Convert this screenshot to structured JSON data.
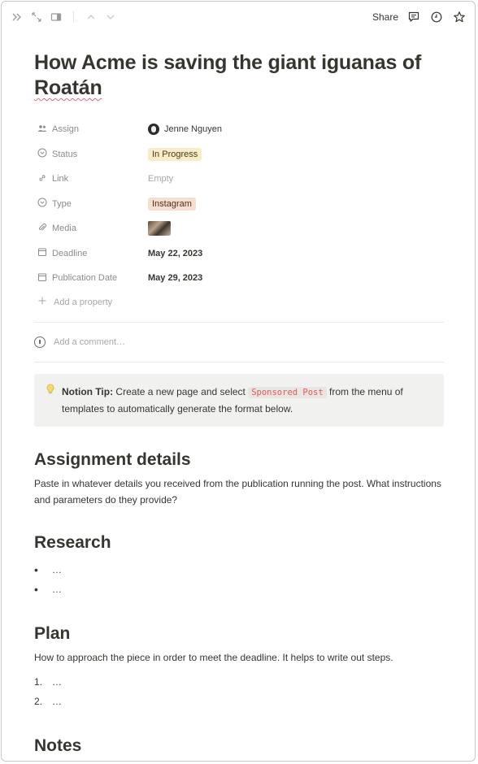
{
  "topbar": {
    "share_label": "Share",
    "icons": [
      "double-chevron-right-icon",
      "expand-icon",
      "sidebar-toggle-icon",
      "chevron-up-icon",
      "chevron-down-icon",
      "comment-icon",
      "clock-icon",
      "star-icon",
      "more-icon"
    ]
  },
  "page": {
    "title_part1": "How Acme is saving the giant iguanas of ",
    "title_part2": "Roatán"
  },
  "properties": [
    {
      "key": "Assign",
      "value": "Jenne Nguyen"
    },
    {
      "key": "Status",
      "value": "In Progress"
    },
    {
      "key": "Link",
      "value": "Empty"
    },
    {
      "key": "Type",
      "value": "Instagram"
    },
    {
      "key": "Media",
      "value": ""
    },
    {
      "key": "Deadline",
      "value": "May 22, 2023"
    },
    {
      "key": "Publication Date",
      "value": "May 29, 2023"
    }
  ],
  "add_property_label": "Add a property",
  "comment_placeholder": "Add a comment…",
  "callout": {
    "bold": "Notion Tip:",
    "text1": " Create a new page and select ",
    "code": "Sponsored Post",
    "text2": " from the menu of templates to automatically generate the format below."
  },
  "sections": {
    "assignment": {
      "heading": "Assignment details",
      "body": "Paste in whatever details you received from the publication running the post. What instructions and parameters do they provide?"
    },
    "research": {
      "heading": "Research",
      "items": [
        "…",
        "…"
      ]
    },
    "plan": {
      "heading": "Plan",
      "body": "How to approach the piece in order to meet the deadline. It helps to write out steps.",
      "items": [
        {
          "n": "1.",
          "t": "…"
        },
        {
          "n": "2.",
          "t": "…"
        }
      ]
    },
    "notes": {
      "heading": "Notes"
    }
  },
  "colors": {
    "status_tag_bg": "#f8ecc9",
    "type_tag_bg": "#f6dfcf",
    "code_text": "#eb5757",
    "callout_bg": "#f1f1ef"
  }
}
